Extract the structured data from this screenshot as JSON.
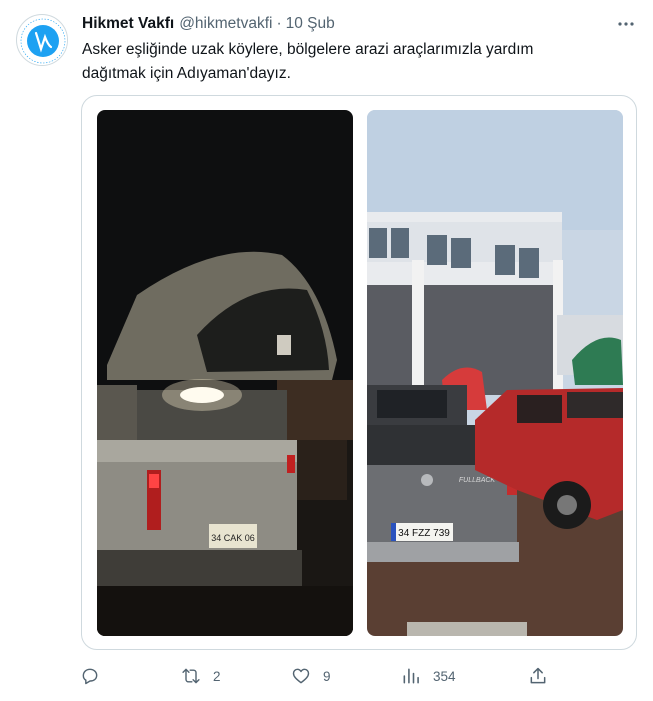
{
  "tweet": {
    "author_name": "Hikmet Vakfı",
    "author_handle": "@hikmetvakfi",
    "separator": "·",
    "date": "10 Şub",
    "text_lines": [
      "Asker eşliğinde uzak köylere, bölgelere arazi araçlarımızla yardım",
      "dağıtmak için Adıyaman'dayız."
    ],
    "avatar_logo": {
      "arc_text": "HİKMET EĞİTİM VE KÜLTÜR VAKFI",
      "year": "1996"
    },
    "photos": {
      "left_plate": "34 CAK 06",
      "right_plate": "34 FZZ 739",
      "right_badge": "FULLBACK"
    },
    "metrics": {
      "replies": "",
      "retweets": "2",
      "likes": "9",
      "views": "354"
    }
  },
  "colors": {
    "text_primary": "#0f1419",
    "text_secondary": "#536471",
    "border": "#cfd9de",
    "logo_blue": "#1da1f2"
  },
  "icons": {
    "more": "more-horizontal-icon",
    "reply": "reply-icon",
    "retweet": "retweet-icon",
    "like": "heart-icon",
    "views": "views-chart-icon",
    "share": "share-icon"
  }
}
